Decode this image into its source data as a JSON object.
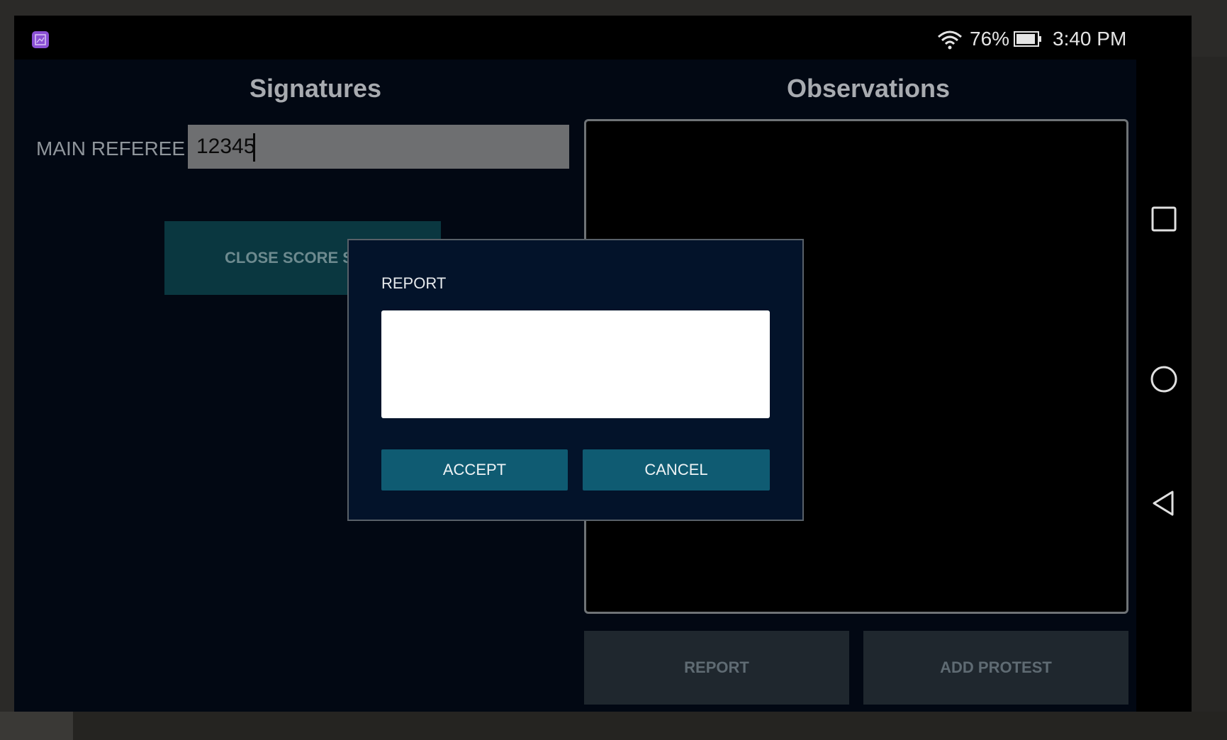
{
  "status_bar": {
    "battery_percent": "76%",
    "time": "3:40 PM",
    "icons": [
      "app-notification-icon",
      "wifi-icon",
      "battery-icon"
    ]
  },
  "signatures": {
    "title": "Signatures",
    "main_referee_label": "MAIN REFEREE",
    "main_referee_value": "12345",
    "close_score_sheet_label": "CLOSE SCORE SH"
  },
  "observations": {
    "title": "Observations",
    "report_button_label": "REPORT",
    "add_protest_button_label": "ADD PROTEST"
  },
  "dialog": {
    "title": "REPORT",
    "text_value": "",
    "accept_label": "ACCEPT",
    "cancel_label": "CANCEL"
  },
  "nav_bar": {
    "icons": [
      "recents-square-icon",
      "home-circle-icon",
      "back-triangle-icon"
    ]
  },
  "colors": {
    "background": "#020813",
    "teal_button": "#0f5b72",
    "dim_teal_button": "#0a3740",
    "dialog_background": "#03132a",
    "input_gray": "#6e6f71"
  }
}
